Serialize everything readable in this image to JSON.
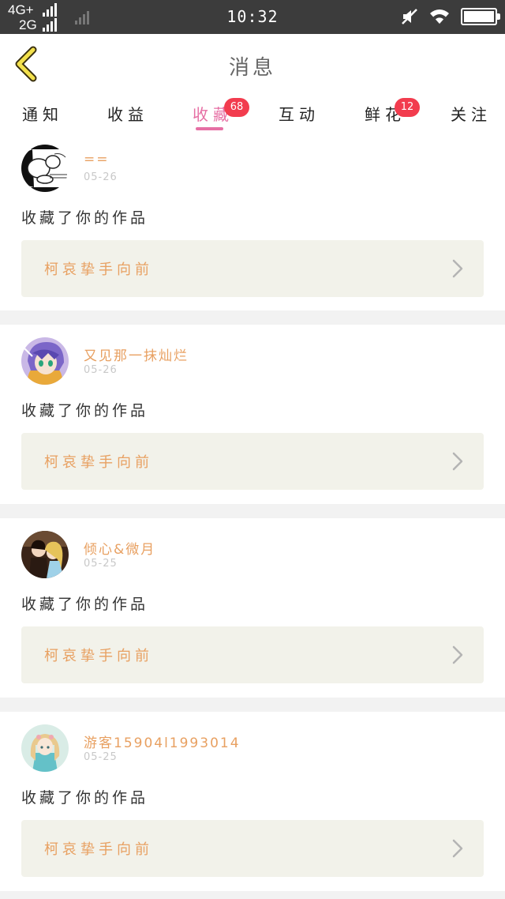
{
  "status_bar": {
    "network_1": "4G+",
    "network_2": "2G",
    "time": "10:32"
  },
  "header": {
    "title": "消息",
    "back_icon": "back-chevron-icon"
  },
  "tabs": [
    {
      "label": "通知",
      "active": false
    },
    {
      "label": "收益",
      "active": false
    },
    {
      "label": "收藏",
      "active": true,
      "badge": "68"
    },
    {
      "label": "互动",
      "active": false
    },
    {
      "label": "鲜花",
      "active": false,
      "badge": "12"
    },
    {
      "label": "关注",
      "active": false
    }
  ],
  "colors": {
    "accent": "#e66fa4",
    "badge": "#f23c4e",
    "username": "#e8a061",
    "work_box": "#f2f2ea"
  },
  "notifications": [
    {
      "username": "==",
      "date": "05-26",
      "action": "收藏了你的作品",
      "work_title": "柯哀挚手向前"
    },
    {
      "username": "又见那一抹灿烂",
      "date": "05-26",
      "action": "收藏了你的作品",
      "work_title": "柯哀挚手向前"
    },
    {
      "username": "倾心&微月",
      "date": "05-25",
      "action": "收藏了你的作品",
      "work_title": "柯哀挚手向前"
    },
    {
      "username": "游客15904l1993014",
      "date": "05-25",
      "action": "收藏了你的作品",
      "work_title": "柯哀挚手向前"
    }
  ]
}
